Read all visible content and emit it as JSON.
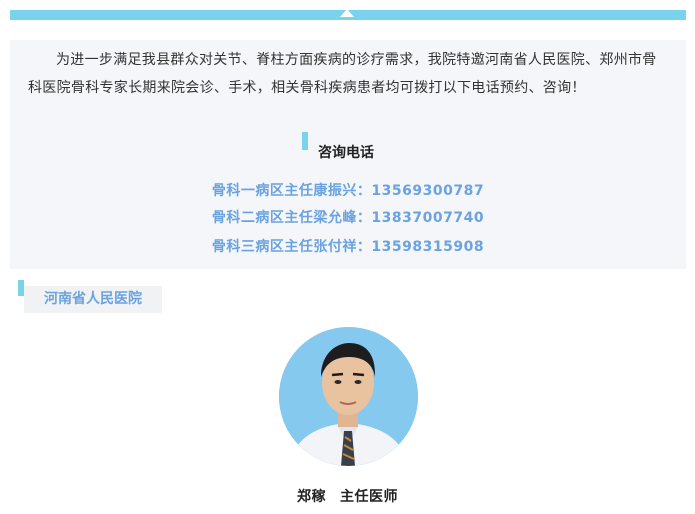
{
  "intro": "为进一步满足我县群众对关节、脊柱方面疾病的诊疗需求，我院特邀河南省人民医院、郑州市骨科医院骨科专家长期来院会诊、手术，相关骨科疾病患者均可拨打以下电话预约、咨询！",
  "consult_title": "咨询电话",
  "contacts": [
    "骨科一病区主任康振兴：13569300787",
    "骨科二病区主任梁允峰：13837007740",
    "骨科三病区主任张付祥：13598315908"
  ],
  "hospital_tag": "河南省人民医院",
  "doctor": {
    "name": "郑稼",
    "title": "主任医师"
  },
  "colors": {
    "accent": "#7ad3ec",
    "link_blue": "#6aa3e0",
    "panel_bg": "#f5f6fa"
  }
}
